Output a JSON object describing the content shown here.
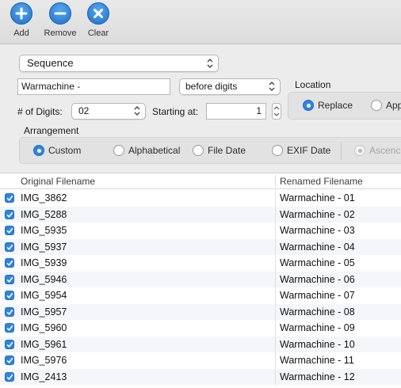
{
  "toolbar": {
    "add_label": "Add",
    "remove_label": "Remove",
    "clear_label": "Clear"
  },
  "options": {
    "mode_value": "Sequence",
    "text_value": "Warmachine -",
    "position_value": "before digits",
    "location_label": "Location",
    "location_options": [
      "Replace",
      "App"
    ],
    "location_selected": "Replace",
    "digits_label": "# of Digits:",
    "digits_value": "02",
    "starting_label": "Starting at:",
    "starting_value": "1",
    "arrangement_label": "Arrangement",
    "arrangement_options": [
      "Custom",
      "Alphabetical",
      "File Date",
      "EXIF Date",
      "Ascenc"
    ],
    "arrangement_selected": "Custom"
  },
  "table": {
    "columns": [
      "Original Filename",
      "Renamed Filename"
    ],
    "rows": [
      {
        "checked": true,
        "original": "IMG_3862",
        "renamed": "Warmachine - 01"
      },
      {
        "checked": true,
        "original": "IMG_5288",
        "renamed": "Warmachine - 02"
      },
      {
        "checked": true,
        "original": "IMG_5935",
        "renamed": "Warmachine - 03"
      },
      {
        "checked": true,
        "original": "IMG_5937",
        "renamed": "Warmachine - 04"
      },
      {
        "checked": true,
        "original": "IMG_5939",
        "renamed": "Warmachine - 05"
      },
      {
        "checked": true,
        "original": "IMG_5946",
        "renamed": "Warmachine - 06"
      },
      {
        "checked": true,
        "original": "IMG_5954",
        "renamed": "Warmachine - 07"
      },
      {
        "checked": true,
        "original": "IMG_5957",
        "renamed": "Warmachine - 08"
      },
      {
        "checked": true,
        "original": "IMG_5960",
        "renamed": "Warmachine - 09"
      },
      {
        "checked": true,
        "original": "IMG_5961",
        "renamed": "Warmachine - 10"
      },
      {
        "checked": true,
        "original": "IMG_5976",
        "renamed": "Warmachine - 11"
      },
      {
        "checked": true,
        "original": "IMG_2413",
        "renamed": "Warmachine - 12"
      }
    ]
  },
  "colors": {
    "accent": "#2f84e0",
    "toolbar_icon": "#1f6fc8"
  }
}
